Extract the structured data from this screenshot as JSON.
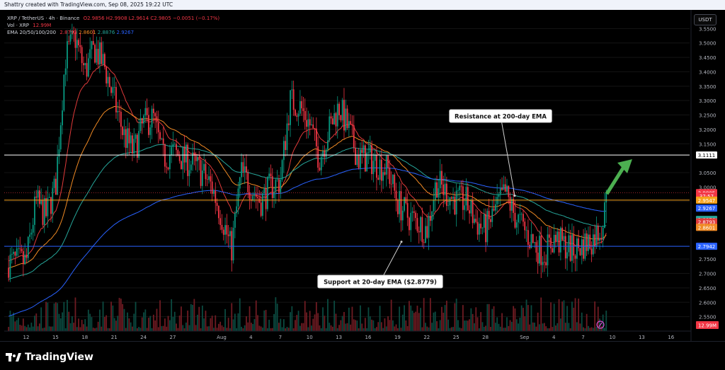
{
  "header": {
    "created_by": "Shattry created with TradingView.com, Sep 08, 2025 19:22 UTC"
  },
  "legend": {
    "symbol": "XRP / TetherUS · 4h · Binance",
    "ohlc": "O2.9856  H2.9908  L2.9614  C2.9805  −0.0051 (−0.17%)",
    "vol_label": "Vol · XRP",
    "vol_value": "12.99M",
    "ema_label": "EMA 20/50/100/200",
    "ema20": "2.8793",
    "ema50": "2.8601",
    "ema100": "2.8876",
    "ema200": "2.9267"
  },
  "currency_badge": "USDT",
  "footer": {
    "brand": "TradingView"
  },
  "colors": {
    "background": "#000000",
    "up": "#089981",
    "down": "#f23645",
    "ema20": "#e03a3a",
    "ema50": "#f08a24",
    "ema100": "#26a69a",
    "ema200": "#2962ff",
    "resistance_line": "#ffffff",
    "orange_line": "#f7a21b",
    "support_line": "#2962ff",
    "arrow": "#4caf50"
  },
  "chart_data": {
    "type": "candlestick",
    "title": "XRP / TetherUS · 4h · Binance",
    "ylim": [
      2.5,
      3.6
    ],
    "y_ticks": [
      "3.5500",
      "3.5000",
      "3.4500",
      "3.4000",
      "3.3500",
      "3.3000",
      "3.2500",
      "3.2000",
      "3.1500",
      "3.0500",
      "3.0000",
      "2.9500",
      "2.7500",
      "2.7000",
      "2.6500",
      "2.6000",
      "2.5500"
    ],
    "x_ticks": [
      "12",
      "15",
      "18",
      "21",
      "24",
      "27",
      "Aug",
      "4",
      "7",
      "10",
      "13",
      "16",
      "19",
      "22",
      "25",
      "28",
      "Sep",
      "4",
      "7",
      "10",
      "13",
      "16"
    ],
    "closes_day_series": [
      [
        0,
        2.74
      ],
      [
        1,
        2.95
      ],
      [
        2,
        2.9
      ],
      [
        3,
        3.0
      ],
      [
        4,
        3.45
      ],
      [
        5,
        3.52
      ],
      [
        6,
        3.4
      ],
      [
        7,
        3.48
      ],
      [
        8,
        3.42
      ],
      [
        9,
        3.3
      ],
      [
        10,
        3.18
      ],
      [
        11,
        3.12
      ],
      [
        12,
        3.22
      ],
      [
        13,
        3.24
      ],
      [
        14,
        3.1
      ],
      [
        15,
        3.12
      ],
      [
        16,
        3.1
      ],
      [
        17,
        3.08
      ],
      [
        18,
        3.05
      ],
      [
        19,
        3.0
      ],
      [
        20,
        2.9
      ],
      [
        21,
        2.78
      ],
      [
        22,
        3.05
      ],
      [
        23,
        3.0
      ],
      [
        24,
        2.95
      ],
      [
        25,
        3.0
      ],
      [
        26,
        3.02
      ],
      [
        27,
        3.3
      ],
      [
        28,
        3.28
      ],
      [
        29,
        3.22
      ],
      [
        30,
        3.1
      ],
      [
        31,
        3.2
      ],
      [
        32,
        3.28
      ],
      [
        33,
        3.2
      ],
      [
        34,
        3.1
      ],
      [
        35,
        3.1
      ],
      [
        36,
        3.08
      ],
      [
        37,
        3.06
      ],
      [
        38,
        2.95
      ],
      [
        39,
        2.9
      ],
      [
        40,
        2.88
      ],
      [
        41,
        2.85
      ],
      [
        42,
        3.02
      ],
      [
        43,
        2.98
      ],
      [
        44,
        2.95
      ],
      [
        45,
        2.95
      ],
      [
        46,
        2.88
      ],
      [
        47,
        2.85
      ],
      [
        48,
        2.92
      ],
      [
        49,
        2.98
      ],
      [
        50,
        2.9
      ],
      [
        51,
        2.85
      ],
      [
        52,
        2.8
      ],
      [
        53,
        2.77
      ],
      [
        54,
        2.82
      ],
      [
        55,
        2.8
      ],
      [
        56,
        2.78
      ],
      [
        57,
        2.8
      ],
      [
        58,
        2.82
      ],
      [
        59,
        2.87
      ],
      [
        59.5,
        2.98
      ]
    ],
    "ema_current": {
      "ema20": 2.8793,
      "ema50": 2.8601,
      "ema100": 2.8876,
      "ema200": 2.9267
    },
    "price_labels": [
      {
        "text": "3.1111",
        "value": 3.1111,
        "color": "#ffffff",
        "text_color": "#000000"
      },
      {
        "text": "2.9805",
        "value": 2.9805,
        "color": "#f23645",
        "text_color": "#ffffff"
      },
      {
        "text": "37:57",
        "value": 2.9685,
        "color": "#f23645",
        "text_color": "#ffffff"
      },
      {
        "text": "2.9547",
        "value": 2.9547,
        "color": "#f7a21b",
        "text_color": "#ffffff"
      },
      {
        "text": "2.9267",
        "value": 2.9267,
        "color": "#2962ff",
        "text_color": "#ffffff"
      },
      {
        "text": "2.8876",
        "value": 2.8876,
        "color": "#26a69a",
        "text_color": "#ffffff"
      },
      {
        "text": "2.8793",
        "value": 2.8793,
        "color": "#e03a3a",
        "text_color": "#ffffff"
      },
      {
        "text": "2.8601",
        "value": 2.8601,
        "color": "#f08a24",
        "text_color": "#ffffff"
      },
      {
        "text": "2.7942",
        "value": 2.7942,
        "color": "#2962ff",
        "text_color": "#ffffff"
      }
    ],
    "horizontal_lines": [
      {
        "value": 3.1111,
        "color": "#ffffff"
      },
      {
        "value": 2.9547,
        "color": "#f7a21b"
      },
      {
        "value": 2.7942,
        "color": "#2962ff"
      }
    ],
    "volume_label": "12.99M",
    "annotations": [
      {
        "text": "Resistance at 200-day EMA"
      },
      {
        "text": "Support at 20-day EMA ($2.8779)"
      }
    ]
  }
}
